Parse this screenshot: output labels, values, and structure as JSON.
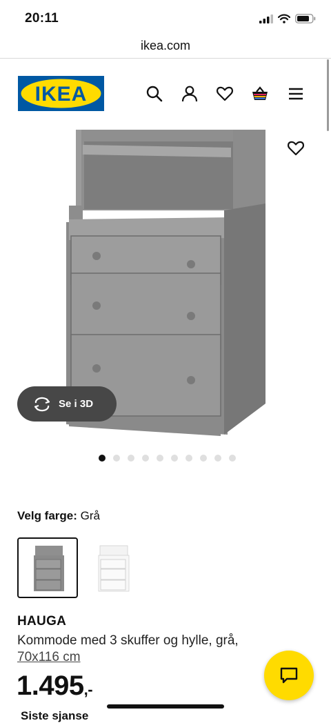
{
  "status_bar": {
    "time": "20:11"
  },
  "browser": {
    "url": "ikea.com"
  },
  "header": {
    "logo_text": "IKEA",
    "icons": [
      "search-icon",
      "account-icon",
      "wishlist-icon",
      "cart-icon",
      "menu-icon"
    ],
    "colors": {
      "logo_blue": "#0058a3",
      "logo_yellow": "#ffdb00"
    }
  },
  "gallery": {
    "view_3d_label": "Se i 3D",
    "total_images": 10,
    "active_index": 0
  },
  "color_selector": {
    "label": "Velg farge:",
    "selected": "Grå",
    "options": [
      "Grå",
      "Hvit"
    ]
  },
  "product": {
    "name": "HAUGA",
    "description": "Kommode med 3 skuffer og hylle, grå,",
    "dimensions": "70x116 cm",
    "price_main": "1.495",
    "price_suffix": ",-"
  },
  "recently_viewed_label": "Siste sjanse",
  "chat": {
    "accent": "#ffdb00"
  }
}
